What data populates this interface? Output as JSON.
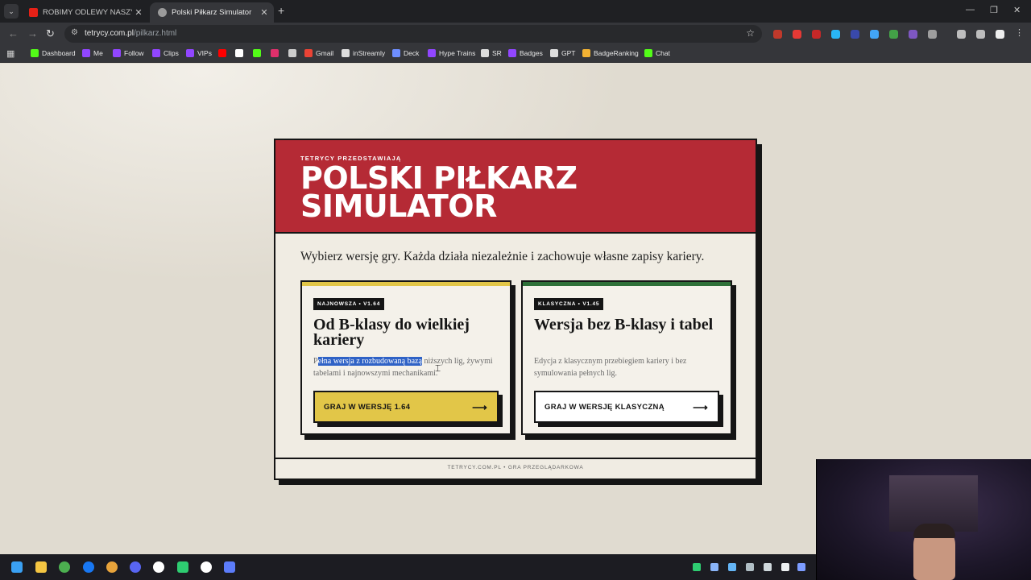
{
  "browser": {
    "tabs": [
      {
        "title": "ROBIMY ODLEWY NASZYCH CI"
      },
      {
        "title": "Polski Piłkarz Simulator"
      }
    ],
    "url_host": "tetrycy.com.pl",
    "url_path": "/pilkarz.html",
    "bookmarks": [
      {
        "label": "Dashboard",
        "color": "#53fc18"
      },
      {
        "label": "Me",
        "color": "#9146ff"
      },
      {
        "label": "Follow",
        "color": "#9146ff"
      },
      {
        "label": "Clips",
        "color": "#9146ff"
      },
      {
        "label": "VIPs",
        "color": "#9146ff"
      },
      {
        "label": "",
        "color": "#ff0000"
      },
      {
        "label": "",
        "color": "#ffffff"
      },
      {
        "label": "",
        "color": "#53fc18"
      },
      {
        "label": "",
        "color": "#e1306c"
      },
      {
        "label": "",
        "color": "#cccccc"
      },
      {
        "label": "Gmail",
        "color": "#ea4335"
      },
      {
        "label": "inStreamly",
        "color": "#dddddd"
      },
      {
        "label": "Deck",
        "color": "#6e8eff"
      },
      {
        "label": "Hype Trains",
        "color": "#9146ff"
      },
      {
        "label": "SR",
        "color": "#dddddd"
      },
      {
        "label": "Badges",
        "color": "#9146ff"
      },
      {
        "label": "GPT",
        "color": "#dddddd"
      },
      {
        "label": "BadgeRanking",
        "color": "#f2b233"
      },
      {
        "label": "Chat",
        "color": "#53fc18"
      }
    ]
  },
  "page": {
    "kicker": "TETRYCY PRZEDSTAWIAJĄ",
    "title": "POLSKI PIŁKARZ SIMULATOR",
    "intro": "Wybierz wersję gry. Każda działa niezależnie i zachowuje własne zapisy kariery.",
    "versions": [
      {
        "badge": "NAJNOWSZA • V1.64",
        "title": "Od B-klasy do wielkiej kariery",
        "desc_prefix": "P",
        "desc_selected": "ełna wersja z rozbudowaną bazą",
        "desc_rest": " niższych lig, żywymi tabelami i najnowszymi mechanikami.",
        "button": "GRAJ W WERSJĘ 1.64",
        "accent": "#e2c648"
      },
      {
        "badge": "KLASYCZNA • V1.45",
        "title": "Wersja bez B-klasy i tabel",
        "desc": "Edycja z klasycznym przebiegiem kariery i bez symulowania pełnych lig.",
        "button": "GRAJ W WERSJĘ KLASYCZNĄ",
        "accent": "#2e7038"
      }
    ],
    "footer": "TETRYCY.COM.PL • GRA PRZEGLĄDARKOWA"
  }
}
